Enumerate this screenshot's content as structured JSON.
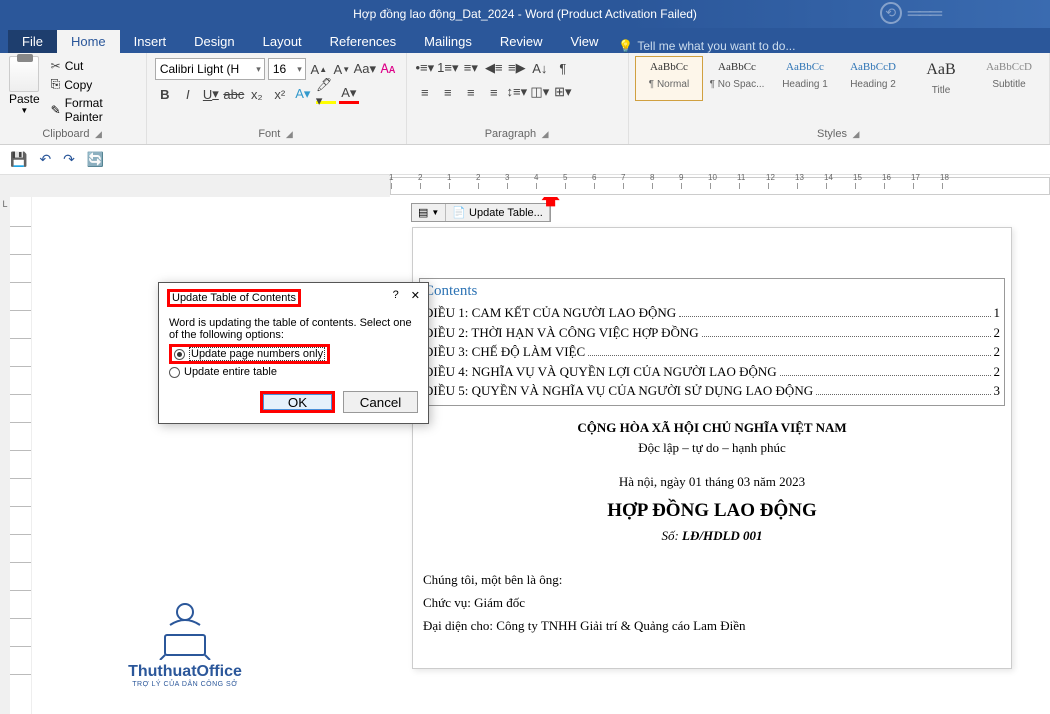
{
  "title": "Hợp đồng lao động_Dat_2024 - Word (Product Activation Failed)",
  "tabs": {
    "file": "File",
    "home": "Home",
    "insert": "Insert",
    "design": "Design",
    "layout": "Layout",
    "references": "References",
    "mailings": "Mailings",
    "review": "Review",
    "view": "View",
    "tellme": "Tell me what you want to do..."
  },
  "clipboard": {
    "paste": "Paste",
    "cut": "Cut",
    "copy": "Copy",
    "fp": "Format Painter",
    "label": "Clipboard"
  },
  "font": {
    "name": "Calibri Light (H",
    "size": "16",
    "label": "Font",
    "b": "B",
    "i": "I",
    "u": "U"
  },
  "para": {
    "label": "Paragraph"
  },
  "styles": {
    "label": "Styles",
    "items": [
      {
        "preview": "AaBbCc",
        "name": "¶ Normal"
      },
      {
        "preview": "AaBbCc",
        "name": "¶ No Spac..."
      },
      {
        "preview": "AaBbCc",
        "name": "Heading 1"
      },
      {
        "preview": "AaBbCcD",
        "name": "Heading 2"
      },
      {
        "preview": "AaB",
        "name": "Title"
      },
      {
        "preview": "AaBbCcD",
        "name": "Subtitle"
      }
    ]
  },
  "toc_ctrl": {
    "update": "Update Table..."
  },
  "toc": {
    "title": "Contents",
    "rows": [
      {
        "t": "ĐIỀU 1: CAM KẾT CỦA NGƯỜI LAO ĐỘNG",
        "p": "1"
      },
      {
        "t": "ĐIỀU 2: THỜI HẠN VÀ CÔNG VIỆC HỢP ĐỒNG",
        "p": "2"
      },
      {
        "t": "ĐIỀU 3: CHẾ ĐỘ LÀM VIỆC",
        "p": "2"
      },
      {
        "t": "ĐIỀU 4: NGHĨA VỤ VÀ QUYỀN LỢI CỦA NGƯỜI LAO ĐỘNG",
        "p": "2"
      },
      {
        "t": "ĐIỀU 5: QUYỀN VÀ NGHĨA VỤ CỦA NGƯỜI SỬ DỤNG LAO ĐỘNG",
        "p": "3"
      }
    ]
  },
  "doc": {
    "l1": "CỘNG HÒA XÃ HỘI CHỦ NGHĨA VIỆT NAM",
    "l2": "Độc lập – tự do – hạnh phúc",
    "l3": "Hà nội, ngày 01 tháng 03 năm 2023",
    "l4": "HỢP ĐỒNG LAO ĐỘNG",
    "l5a": "Số: ",
    "l5b": "LĐ/HDLD 001",
    "p1": "Chúng tôi, một bên là ông:",
    "p2": "Chức vụ: Giám đốc",
    "p3": "Đại diện cho: Công ty TNHH Giải trí & Quảng cáo Lam Điền"
  },
  "dialog": {
    "title": "Update Table of Contents",
    "msg": "Word is updating the table of contents.  Select one of the following options:",
    "opt1": "Update page numbers only",
    "opt2": "Update entire table",
    "ok": "OK",
    "cancel": "Cancel",
    "help": "?",
    "close": "✕"
  },
  "watermark": {
    "brand": "ThuthuatOffice",
    "sub": "TRỢ LÝ CỦA DÂN CÔNG SỞ"
  }
}
